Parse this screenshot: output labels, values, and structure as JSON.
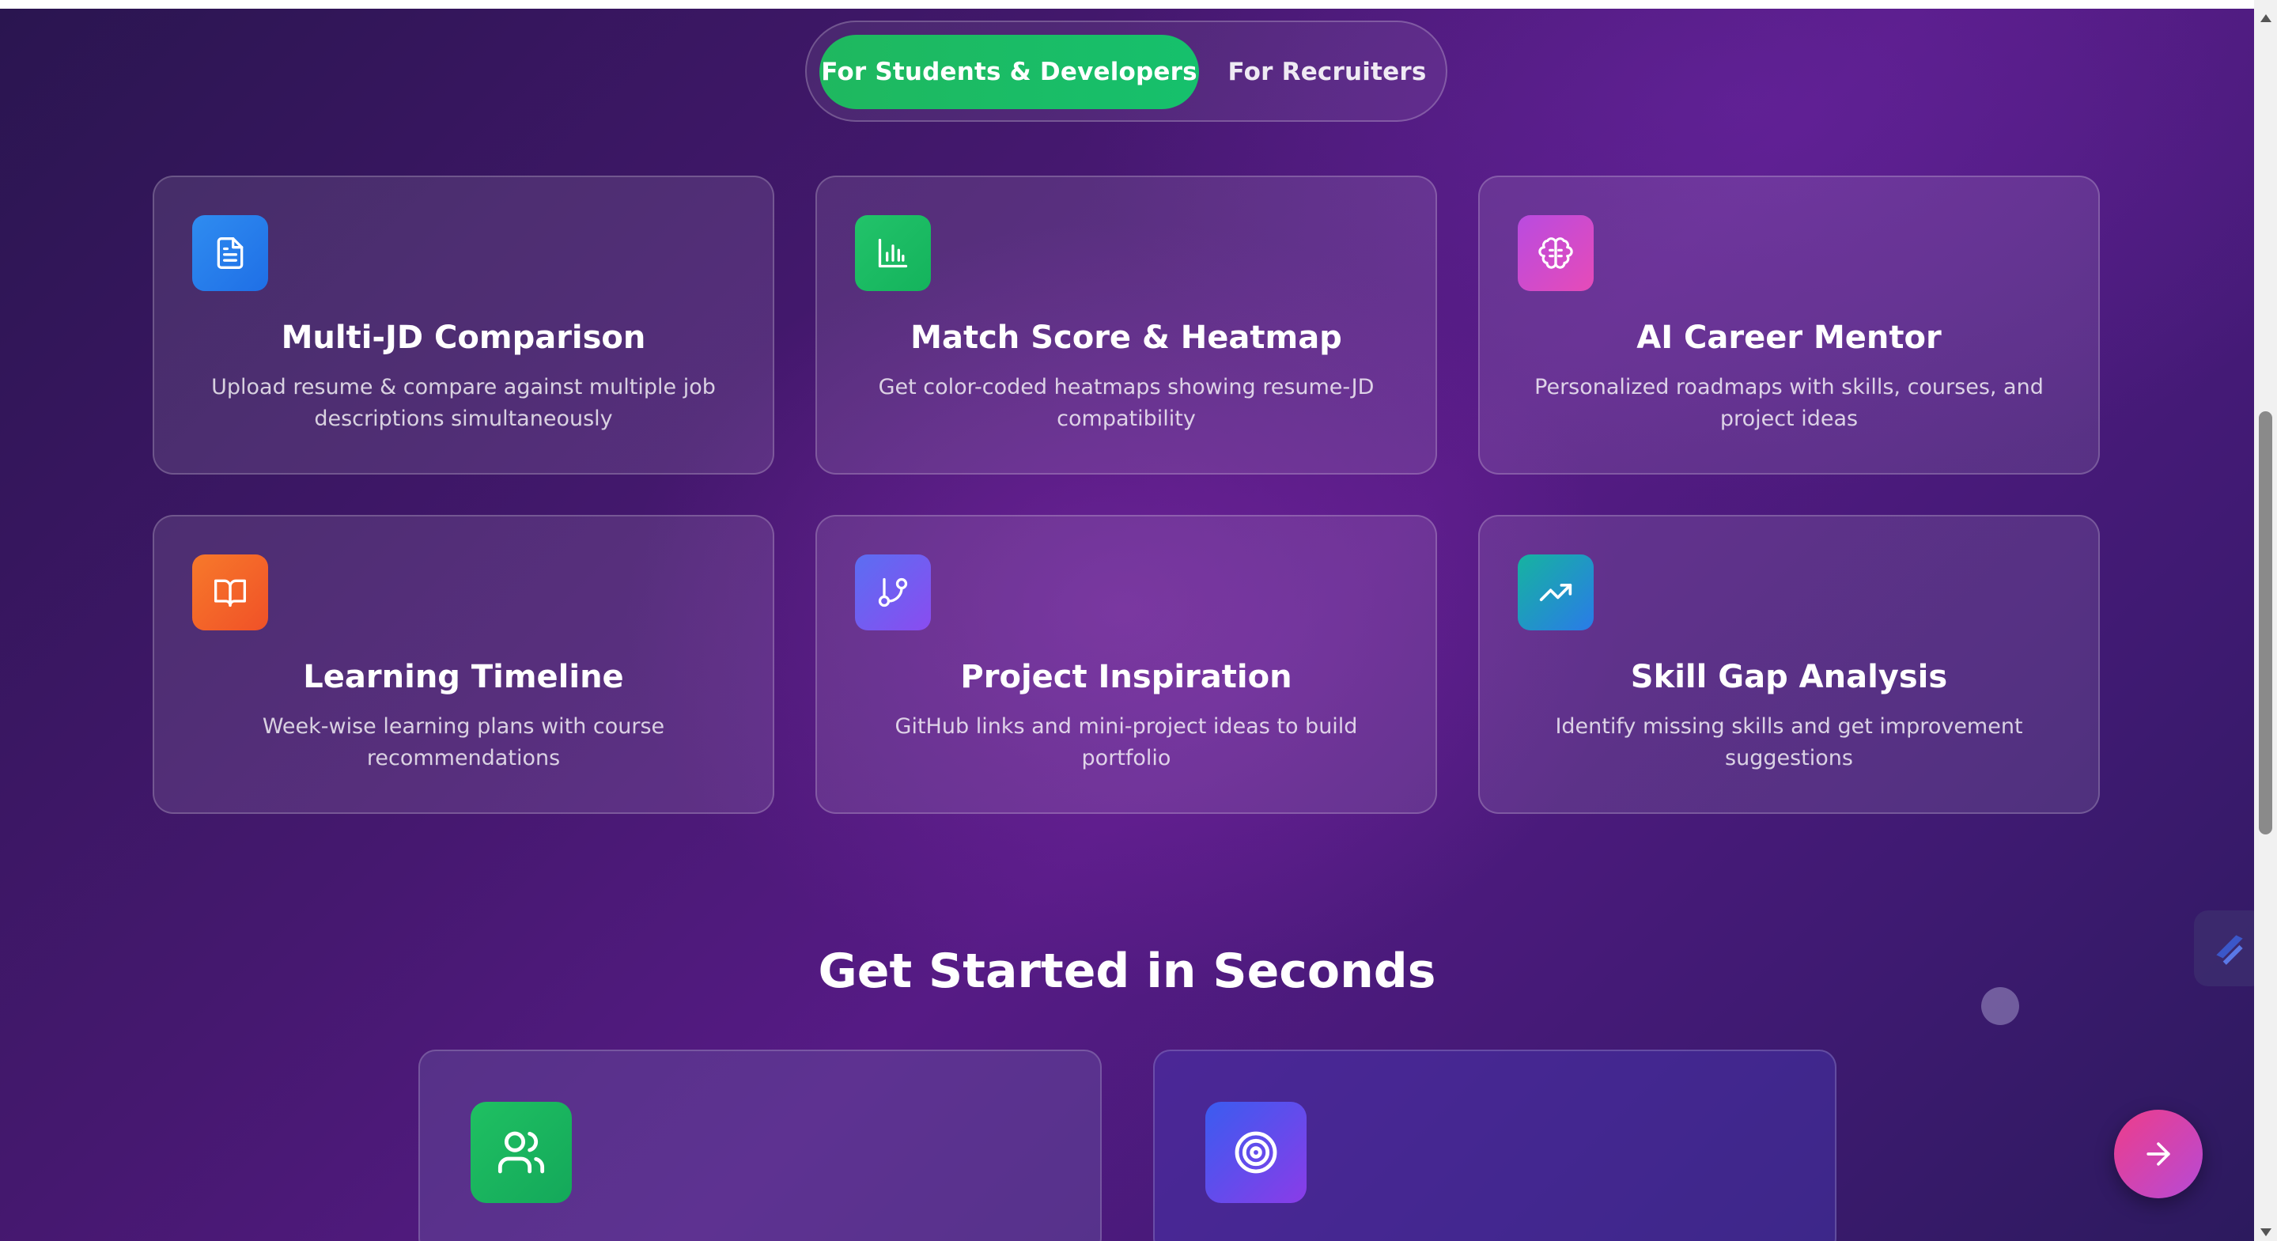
{
  "tabs": {
    "students": "For Students & Developers",
    "recruiters": "For Recruiters",
    "active": "students"
  },
  "features": [
    {
      "title": "Multi-JD Comparison",
      "description": "Upload resume & compare against multiple job descriptions simultaneously",
      "icon": "document-icon",
      "color_from": "#2f8cf0",
      "color_to": "#1f6fe6"
    },
    {
      "title": "Match Score & Heatmap",
      "description": "Get color-coded heatmaps showing resume-JD compatibility",
      "icon": "bar-chart-icon",
      "color_from": "#22c36a",
      "color_to": "#14b35c"
    },
    {
      "title": "AI Career Mentor",
      "description": "Personalized roadmaps with skills, courses, and project ideas",
      "icon": "brain-icon",
      "color_from": "#b94be0",
      "color_to": "#e64bb8"
    },
    {
      "title": "Learning Timeline",
      "description": "Week-wise learning plans with course recommendations",
      "icon": "book-open-icon",
      "color_from": "#f7792a",
      "color_to": "#f05128"
    },
    {
      "title": "Project Inspiration",
      "description": "GitHub links and mini-project ideas to build portfolio",
      "icon": "git-branch-icon",
      "color_from": "#5b6ef2",
      "color_to": "#8a4cf0"
    },
    {
      "title": "Skill Gap Analysis",
      "description": "Identify missing skills and get improvement suggestions",
      "icon": "trending-up-icon",
      "color_from": "#16b3a0",
      "color_to": "#2a7be8"
    }
  ],
  "get_started": {
    "title": "Get Started in Seconds",
    "cards": [
      {
        "icon": "users-icon",
        "color_from": "#1fc062",
        "color_to": "#14a85a"
      },
      {
        "icon": "target-icon",
        "color_from": "#3a5cf0",
        "color_to": "#8a3ce8"
      }
    ]
  },
  "colors": {
    "accent_green": "#1fb85f",
    "fab_pink": "#ee3d8a"
  }
}
